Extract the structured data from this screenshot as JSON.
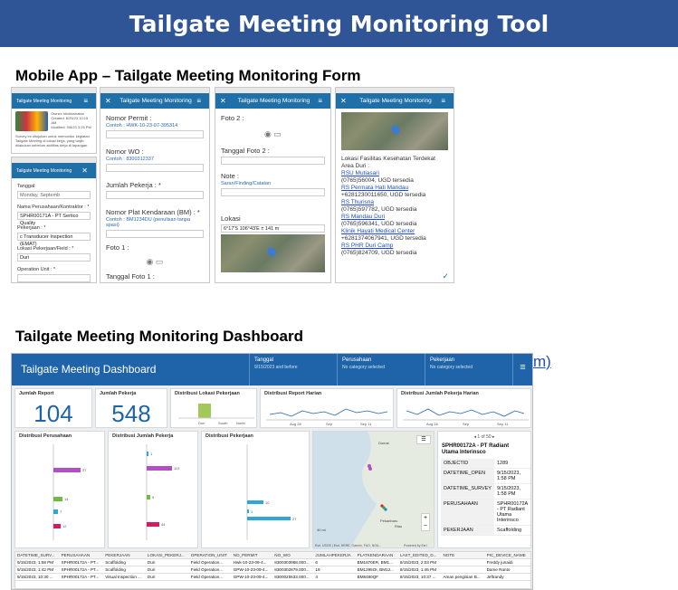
{
  "banner": {
    "title": "Tailgate Meeting Monitoring Tool"
  },
  "mobile_section": {
    "title": "Mobile App – Tailgate Meeting Monitoring Form"
  },
  "dashboard_section": {
    "title": "Tailgate Meeting Monitoring Dashboard"
  },
  "side_link": {
    "text": "m)"
  },
  "screens": {
    "s1": {
      "appbar": "Tailgate Meeting Monitoring",
      "info_lines": [
        "Owner: klinikiwhatan",
        "Created: 8/25/23 10:15 AM",
        "Modified: 9/8/23 3:25 PM"
      ],
      "desc": "Survey ini ditujukan untuk memonitor kegiatan Tailgate Meeting di lokasi kerja, yang wajib dilakukan sebelum aktifitas kerja di lapangan"
    },
    "s2": {
      "appbar": "Tailgate Meeting Monitoring",
      "tanggal_label": "Tanggal:",
      "tanggal_value": "Monday, Septemb",
      "perusahaan_label": "Nama Perusahaan/Kontraktor : *",
      "perusahaan_value": "SPHR00171A - PT Sertico Quality",
      "pekerjaan_label": "Pekerjaan : *",
      "pekerjaan_value": "c Transducer Inspection (EMAT)",
      "lokasi_label": "Lokasi Pekerjaan/Field : *",
      "lokasi_value": "Duri",
      "unit_label": "Operation Unit : *"
    },
    "s3": {
      "appbar": "Tailgate Meeting Monitoring",
      "permit_label": "Nomor Permit :",
      "permit_hint": "Contoh : HWK-10-23-07-395314",
      "wo_label": "Nomor WO :",
      "wo_hint": "Contoh : 8300312337",
      "jumlah_label": "Jumlah Pekerja : *",
      "plat_label": "Nomor Plat Kendaraan (BM) : *",
      "plat_hint": "Contoh : BM1234DU (penulisan tanpa spasi)",
      "foto1_label": "Foto 1 :",
      "tgl_foto1_label": "Tanggal Foto 1 :"
    },
    "s4": {
      "appbar": "Tailgate Meeting Monitoring",
      "foto2_label": "Foto 2 :",
      "tgl_foto2_label": "Tanggal Foto 2 :",
      "note_label": "Note :",
      "note_hint": "Saran/Finding/Catatan",
      "lokasi_label": "Lokasi",
      "coords": "6°17'S 106°43'E ± 141 m"
    },
    "s5": {
      "appbar": "Tailgate Meeting Monitoring",
      "heading": "Lokasi Fasilitas Kesehatan Terdekat Area Duri :",
      "facilities": [
        {
          "name": "RSU Mutiasari",
          "info": "(0765)56004, UGD tersedia"
        },
        {
          "name": "RS Permata Hati Mandau",
          "info": "+6281230011650, UGD tersedia"
        },
        {
          "name": "RS Thurisna",
          "info": "(0765)597782, UGD tersedia"
        },
        {
          "name": "RS Mandau Duri",
          "info": "(0765)596341, UGD tersedia"
        },
        {
          "name": "Klinik Hayati Medical Center",
          "info": "+6281374067941, UGD tersedia"
        },
        {
          "name": "RS PHR Duri Camp",
          "info": "(0765)824709, UGD tersedia"
        }
      ]
    }
  },
  "dashboard": {
    "title": "Tailgate Meeting Dashboard",
    "filters": [
      {
        "label": "Tanggal",
        "value": "9/15/2023 and before"
      },
      {
        "label": "Perusahaan",
        "value": "No category selected"
      },
      {
        "label": "Pekerjaan",
        "value": "No category selected"
      }
    ],
    "jumlah_report": {
      "label": "Jumlah Report",
      "value": "104"
    },
    "jumlah_pekerja": {
      "label": "Jumlah Pekerja",
      "value": "548"
    },
    "dist_lokasi": {
      "label": "Distribusi Lokasi Pekerjaan",
      "categories": [
        "Duri",
        "South",
        "North"
      ]
    },
    "dist_report": {
      "label": "Distribusi Report Harian",
      "ticks": [
        "Aug 28",
        "Sep",
        "Sep 11"
      ]
    },
    "dist_jumlah": {
      "label": "Distribusi Jumlah Pekerja Harian",
      "ticks": [
        "Aug 28",
        "Sep",
        "Sep 11"
      ]
    },
    "dist_perusahaan": {
      "label": "Distribusi Perusahaan",
      "values": [
        "37",
        "14",
        "7",
        "12"
      ]
    },
    "dist_jumlah_perusahaan": {
      "label": "Distribusi Jumlah Pekerja",
      "values": [
        "1",
        "113",
        "9",
        "44"
      ]
    },
    "dist_pekerjaan": {
      "label": "Distribusi Pekerjaan",
      "values": [
        "10",
        "1",
        "27"
      ]
    },
    "map": {
      "labels": [
        "Dumai",
        "Pekanbaru",
        "Riau"
      ],
      "scale": "40 mi",
      "attribution": "Esri, USGS | Esri, HERE, Garmin, FAO, NOA...",
      "powered": "Powered by Esri"
    },
    "record": {
      "pager": "1 of 50",
      "title": "SPHR00172A - PT Radiant Utama Interinsco",
      "rows": [
        {
          "k": "OBJECTID",
          "v": "1289"
        },
        {
          "k": "DATETIME_OPEN",
          "v": "9/15/2023, 1:58 PM"
        },
        {
          "k": "DATETIME_SURVEY",
          "v": "9/15/2023, 1:58 PM"
        },
        {
          "k": "PERUSAHAAN",
          "v": "SPHR00172A - PT Radiant Utama Interinsco"
        },
        {
          "k": "PEKERJAAN",
          "v": "Scaffolding"
        }
      ]
    },
    "table": {
      "headers": [
        "DATETIME_SURV...",
        "PERUSAHAAN",
        "PEKERJAAN",
        "LOKASI_PEKERJ...",
        "OPERATION_UNIT",
        "NO_PERMIT",
        "NO_WO",
        "JUMLAHPEKERJA",
        "PLATKENDARAAN",
        "LAST_EDITED_D...",
        "NOTE",
        "PIC_DEVICE_NAME"
      ],
      "rows": [
        [
          "9/15/2023, 1:58 PM",
          "SPHR00172A - PT...",
          "Scaffolding",
          "Duri",
          "Field Operation...",
          "Hwk-10-23-09-4...",
          "8300303968.000...",
          "6",
          "BM1870ER, BM1...",
          "9/15/2023, 2:03 PM",
          "",
          "Freddy junaidi"
        ],
        [
          "9/15/2023, 1:42 PM",
          "SPHR00172A - PT...",
          "Scaffolding",
          "Duri",
          "Field Operation...",
          "GPW-10-23-09-4...",
          "8300302879.000...",
          "19",
          "BM1295OI, BM12...",
          "9/15/2023, 1:46 PM",
          "",
          "Dame Ranto"
        ],
        [
          "9/15/2023, 10:30 ...",
          "SPHR00172A - PT...",
          "Visual Inspection ...",
          "Duri",
          "Field Operation...",
          "GPW-10-23-09-4...",
          "8300025533.000...",
          "4",
          "BM8480QF",
          "9/15/2023, 10:37 ...",
          "Aman pengisian B...",
          "Jeftrandy"
        ]
      ]
    }
  }
}
